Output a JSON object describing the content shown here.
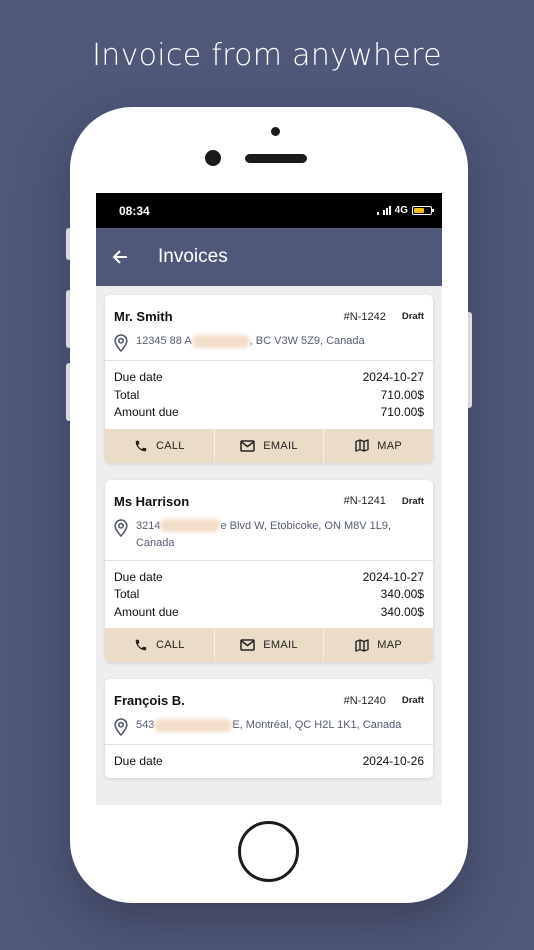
{
  "headline": "Invoice from anywhere",
  "status_bar": {
    "time": "08:34",
    "network": "4G"
  },
  "app_bar": {
    "title": "Invoices"
  },
  "invoices": [
    {
      "customer": "Mr. Smith",
      "number": "#N-1242",
      "status": "Draft",
      "address_start": "12345 88 A",
      "address_end": ", BC V3W 5Z9, Canada",
      "due_date_label": "Due date",
      "due_date": "2024-10-27",
      "total_label": "Total",
      "total": "710.00$",
      "amount_due_label": "Amount due",
      "amount_due": "710.00$",
      "call": "CALL",
      "email": "EMAIL",
      "map": "MAP"
    },
    {
      "customer": "Ms Harrison",
      "number": "#N-1241",
      "status": "Draft",
      "address_start": "3214",
      "address_end": "e Blvd W, Etobicoke, ON M8V 1L9, Canada",
      "due_date_label": "Due date",
      "due_date": "2024-10-27",
      "total_label": "Total",
      "total": "340.00$",
      "amount_due_label": "Amount due",
      "amount_due": "340.00$",
      "call": "CALL",
      "email": "EMAIL",
      "map": "MAP"
    },
    {
      "customer": "François B.",
      "number": "#N-1240",
      "status": "Draft",
      "address_start": "543",
      "address_end": "E, Montréal, QC H2L 1K1, Canada",
      "due_date_label": "Due date",
      "due_date": "2024-10-26"
    }
  ],
  "colors": {
    "background": "#4f5878",
    "app_bar": "#4f5878",
    "action_bar": "#eadcc6"
  }
}
